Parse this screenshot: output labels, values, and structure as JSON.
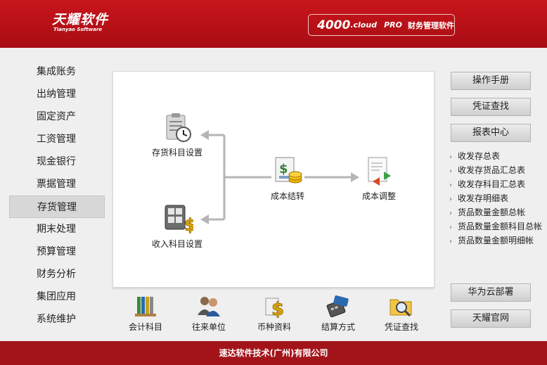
{
  "header": {
    "logo_main": "天耀软件",
    "logo_sub": "Tianyao Software",
    "product_number": "4000",
    "product_cloud": ".cloud",
    "product_edition": "PRO",
    "product_name": "财务管理软件"
  },
  "menu": {
    "items": [
      {
        "label": "集成账务"
      },
      {
        "label": "出纳管理"
      },
      {
        "label": "固定资产"
      },
      {
        "label": "工资管理"
      },
      {
        "label": "现金银行"
      },
      {
        "label": "票据管理"
      },
      {
        "label": "存货管理"
      },
      {
        "label": "期末处理"
      },
      {
        "label": "预算管理"
      },
      {
        "label": "财务分析"
      },
      {
        "label": "集团应用"
      },
      {
        "label": "系统维护"
      }
    ],
    "active_label": "存货管理"
  },
  "flow": {
    "inventory_subject": "存货科目设置",
    "income_subject": "收入科目设置",
    "cost_carryover": "成本结转",
    "cost_adjust": "成本调整"
  },
  "bottom": {
    "items": [
      {
        "label": "会计科目",
        "icon": "ledger-books-icon"
      },
      {
        "label": "往来单位",
        "icon": "people-icon"
      },
      {
        "label": "币种资料",
        "icon": "currency-icon"
      },
      {
        "label": "结算方式",
        "icon": "card-terminal-icon"
      },
      {
        "label": "凭证查找",
        "icon": "folder-search-icon"
      }
    ]
  },
  "right": {
    "manual_button": "操作手册",
    "voucher_button": "凭证查找",
    "report_center_button": "报表中心",
    "reports": [
      {
        "label": "收发存总表"
      },
      {
        "label": "收发存货品汇总表"
      },
      {
        "label": "收发存科目汇总表"
      },
      {
        "label": "收发存明细表"
      },
      {
        "label": "货品数量金额总帐"
      },
      {
        "label": "货品数量金额科目总帐"
      },
      {
        "label": "货品数量金额明细帐"
      }
    ],
    "huawei_button": "华为云部署",
    "website_button": "天耀官网"
  },
  "footer": {
    "company": "速达软件技术(广州)有限公司"
  },
  "colors": {
    "header_red": "#b8111a",
    "footer_red": "#a3141a",
    "arrow_gray": "#b5b5b5"
  }
}
